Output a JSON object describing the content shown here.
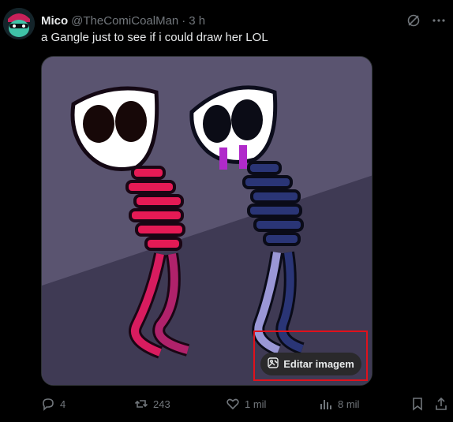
{
  "post": {
    "author_name": "Mico",
    "handle": "@TheComiCoalMan",
    "separator": "·",
    "time": "3 h",
    "text": "a Gangle just to see if i could draw her LOL",
    "image_alt_icon": "artwork-image",
    "edit_image_label": "Editar imagem"
  },
  "actions": {
    "replies": "4",
    "reposts": "243",
    "likes": "1 mil",
    "views": "8 mil"
  },
  "colors": {
    "highlight": "#e0111c",
    "muted": "#71767b"
  },
  "icons": [
    "avatar",
    "grok-icon",
    "more-icon",
    "reply-icon",
    "repost-icon",
    "like-icon",
    "views-icon",
    "bookmark-icon",
    "share-icon",
    "edit-image-icon"
  ]
}
